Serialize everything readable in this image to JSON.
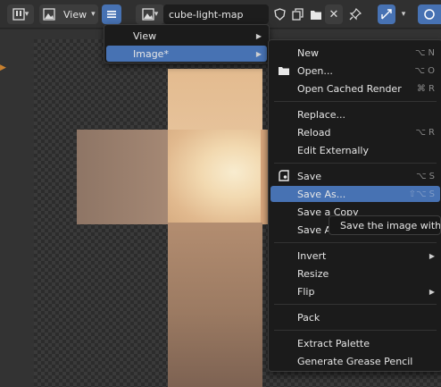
{
  "header": {
    "view_label": "View",
    "image_name": "cube-light-map"
  },
  "view_menu": {
    "items": [
      {
        "label": "View"
      },
      {
        "label": "Image*"
      }
    ]
  },
  "image_menu": {
    "items": [
      {
        "label": "New",
        "shortcut": "⌥ N"
      },
      {
        "label": "Open...",
        "shortcut": "⌥ O"
      },
      {
        "label": "Open Cached Render",
        "shortcut": "⌘ R"
      },
      {
        "label": "Replace...",
        "shortcut": ""
      },
      {
        "label": "Reload",
        "shortcut": "⌥ R"
      },
      {
        "label": "Edit Externally",
        "shortcut": ""
      },
      {
        "label": "Save",
        "shortcut": "⌥ S"
      },
      {
        "label": "Save As...",
        "shortcut": "⇧⌥ S"
      },
      {
        "label": "Save a Copy",
        "shortcut": ""
      },
      {
        "label": "Save A",
        "shortcut": ""
      },
      {
        "label": "Invert",
        "shortcut": ""
      },
      {
        "label": "Resize",
        "shortcut": ""
      },
      {
        "label": "Flip",
        "shortcut": ""
      },
      {
        "label": "Pack",
        "shortcut": ""
      },
      {
        "label": "Extract Palette",
        "shortcut": ""
      },
      {
        "label": "Generate Grease Pencil",
        "shortcut": ""
      }
    ]
  },
  "tooltip": {
    "text": "Save the image with ar"
  },
  "colors": {
    "accent": "#4772b3",
    "menu_bg": "#1b1b1b",
    "header_bg": "#303030"
  }
}
